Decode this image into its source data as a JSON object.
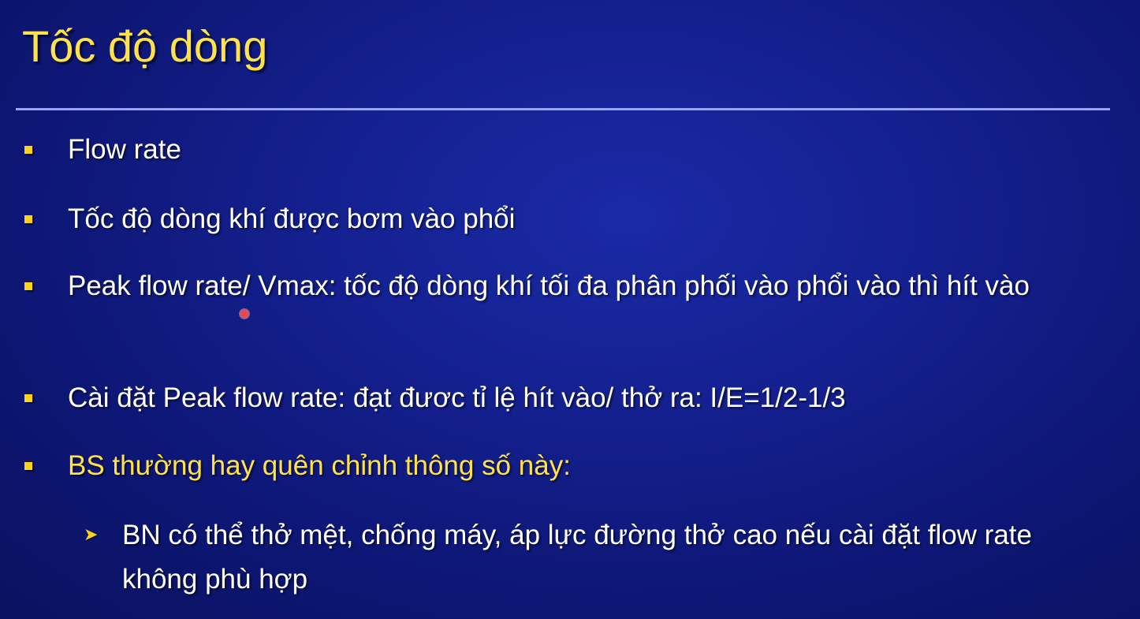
{
  "slide": {
    "title": "Tốc độ dòng",
    "bullets": [
      {
        "text": "Flow rate"
      },
      {
        "text": "Tốc độ dòng khí được bơm vào phổi"
      },
      {
        "text": "Peak flow rate/ Vmax: tốc độ dòng khí tối đa phân phối vào phổi vào thì hít vào"
      },
      {
        "text": "Cài đặt Peak flow rate: đạt đươc tỉ lệ hít vào/ thở ra: I/E=1/2-1/3"
      },
      {
        "text": "BS thường hay quên chỉnh thông số này:"
      }
    ],
    "sub_bullets": [
      {
        "text": "BN có thể thở mệt, chống máy, áp lực đường thở cao nếu cài đặt flow rate không phù hợp"
      }
    ],
    "colors": {
      "title": "#ffe14a",
      "highlight_text": "#ffe14a",
      "bullet_marker": "#ffd21a",
      "body_text": "#ffffff",
      "rule": "#9aa3ff",
      "background": "#14208f"
    }
  }
}
